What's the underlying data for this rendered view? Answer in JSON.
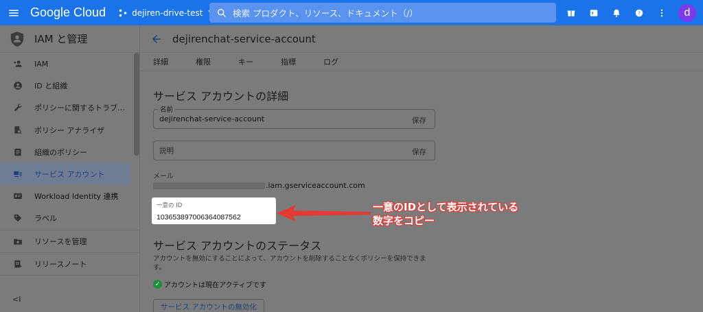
{
  "topbar": {
    "logo": "Google Cloud",
    "project": "dejiren-drive-test",
    "search_placeholder": "検索 プロダクト、リソース、ドキュメント（/）",
    "avatar_letter": "d",
    "color": "#1a73e8"
  },
  "sidebar": {
    "title": "IAM と管理",
    "items": [
      {
        "label": "IAM",
        "icon": "person-add-icon"
      },
      {
        "label": "ID と組織",
        "icon": "account-circle-icon"
      },
      {
        "label": "ポリシーに関するトラブ…",
        "icon": "wrench-icon"
      },
      {
        "label": "ポリシー アナライザ",
        "icon": "doc-search-icon"
      },
      {
        "label": "組織のポリシー",
        "icon": "list-doc-icon"
      },
      {
        "label": "サービス アカウント",
        "icon": "service-account-icon",
        "active": true
      },
      {
        "label": "Workload Identity 連携",
        "icon": "id-card-icon"
      },
      {
        "label": "ラベル",
        "icon": "tag-icon"
      },
      {
        "label": "リソースを管理",
        "icon": "settings-folder-icon"
      },
      {
        "label": "リリースノート",
        "icon": "release-notes-icon"
      }
    ],
    "collapse_label": "<I"
  },
  "main": {
    "title": "dejirenchat-service-account",
    "tabs": [
      "詳細",
      "権限",
      "キー",
      "指標",
      "ログ"
    ],
    "details_title": "サービス アカウントの詳細",
    "name_label": "名前",
    "name_value": "dejirenchat-service-account",
    "save_label": "保存",
    "description_placeholder": "説明",
    "email_label": "メール",
    "email_suffix": ".iam.gserviceaccount.com",
    "uid_label": "一意の ID",
    "uid_value": "103653897006364087562",
    "status_title": "サービス アカウントのステータス",
    "status_text": "アカウントを無効にすることによって、アカウントを削除することなくポリシーを保持できます。",
    "active_text": "アカウントは現在アクティブです",
    "disable_button": "サービス アカウントの無効化"
  },
  "annotation": {
    "line1": "一意のIDとして表示されている",
    "line2": "数字をコピー",
    "color": "#e53935"
  }
}
